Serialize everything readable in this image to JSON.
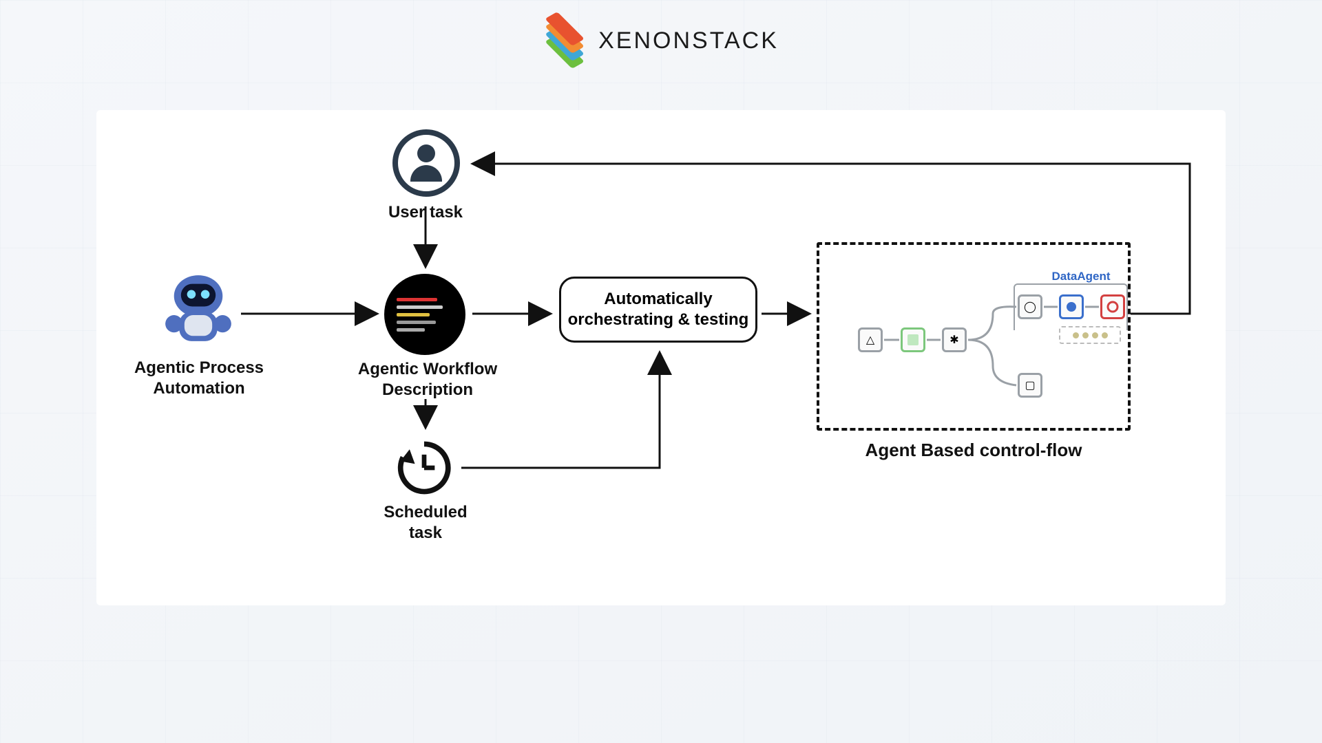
{
  "brand": {
    "name": "XENONSTACK"
  },
  "nodes": {
    "user_task": {
      "label": "User task"
    },
    "agentic_process_automation": {
      "line1": "Agentic Process",
      "line2": "Automation"
    },
    "agentic_workflow_description": {
      "line1": "Agentic Workflow",
      "line2": "Description"
    },
    "scheduled_task": {
      "line1": "Scheduled",
      "line2": "task"
    },
    "orchestrating": {
      "line1": "Automatically",
      "line2": "orchestrating & testing"
    },
    "agent_control_flow": {
      "label": "Agent Based  control-flow"
    },
    "data_agent": {
      "label": "DataAgent"
    }
  }
}
